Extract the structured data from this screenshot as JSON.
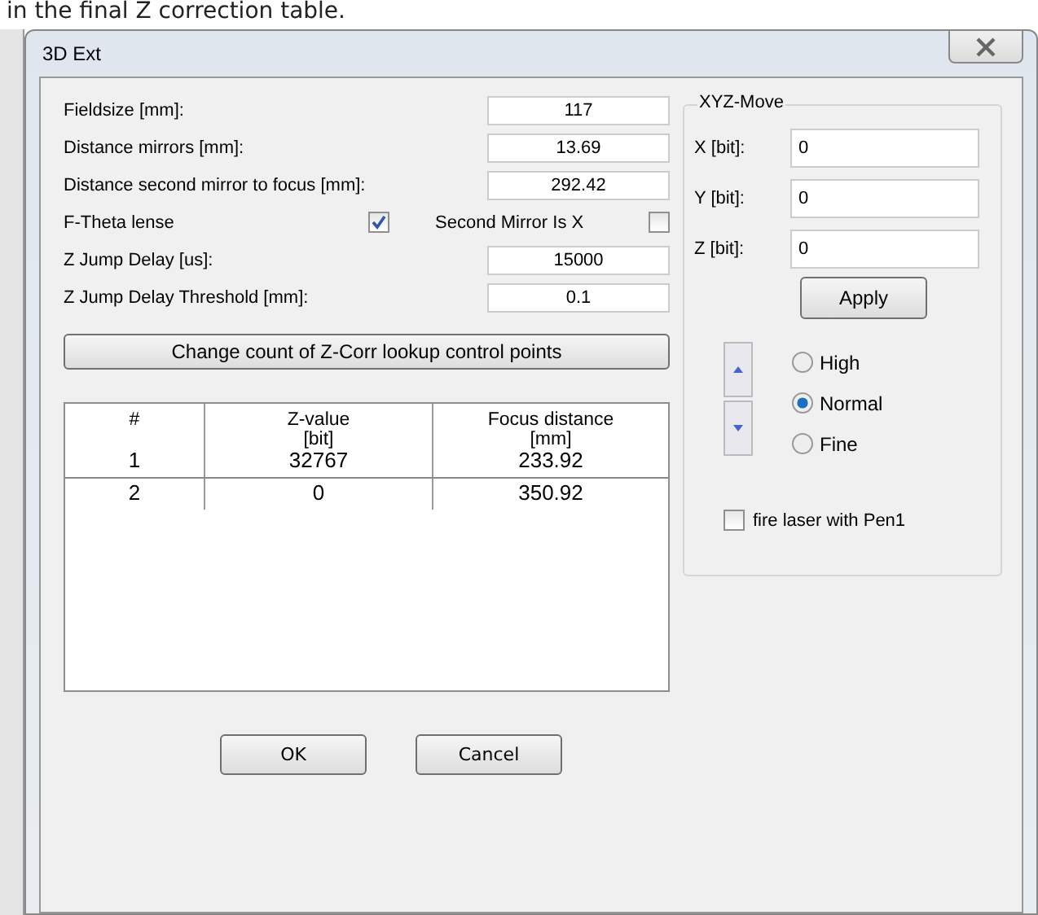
{
  "document_text": "in the final Z correction table.",
  "window": {
    "title": "3D Ext"
  },
  "settings": [
    {
      "kind": "field",
      "label": "Fieldsize [mm]:",
      "value": "117"
    },
    {
      "kind": "field",
      "label": "Distance mirrors [mm]:",
      "value": "13.69"
    },
    {
      "kind": "field",
      "label": "Distance second mirror to focus [mm]:",
      "value": "292.42"
    },
    {
      "kind": "checks",
      "items": [
        {
          "label": "F-Theta lense",
          "checked": true
        },
        {
          "label": "Second Mirror Is X",
          "checked": false
        }
      ]
    },
    {
      "kind": "field",
      "label": "Z Jump Delay [us]:",
      "value": "15000"
    },
    {
      "kind": "field",
      "label": "Z Jump Delay Threshold [mm]:",
      "value": "0.1"
    }
  ],
  "lookup_button": "Change count of Z-Corr lookup control points",
  "table": {
    "columns": [
      {
        "label": "#"
      },
      {
        "label": "Z-value",
        "unit": "[bit]"
      },
      {
        "label": "Focus distance",
        "unit": "[mm]"
      }
    ],
    "rows": [
      [
        "1",
        "32767",
        "233.92"
      ],
      [
        "2",
        "0",
        "350.92"
      ]
    ]
  },
  "buttons": [
    "OK",
    "Cancel"
  ],
  "xyz_move": {
    "title": "XYZ-Move",
    "fields": [
      {
        "label": "X [bit]:",
        "value": "0"
      },
      {
        "label": "Y [bit]:",
        "value": "0"
      },
      {
        "label": "Z [bit]:",
        "value": "0"
      }
    ],
    "apply": "Apply",
    "steps": [
      {
        "label": "High",
        "selected": false
      },
      {
        "label": "Normal",
        "selected": true
      },
      {
        "label": "Fine",
        "selected": false
      }
    ],
    "fire_laser": {
      "label": "fire laser with Pen1",
      "checked": false
    }
  }
}
